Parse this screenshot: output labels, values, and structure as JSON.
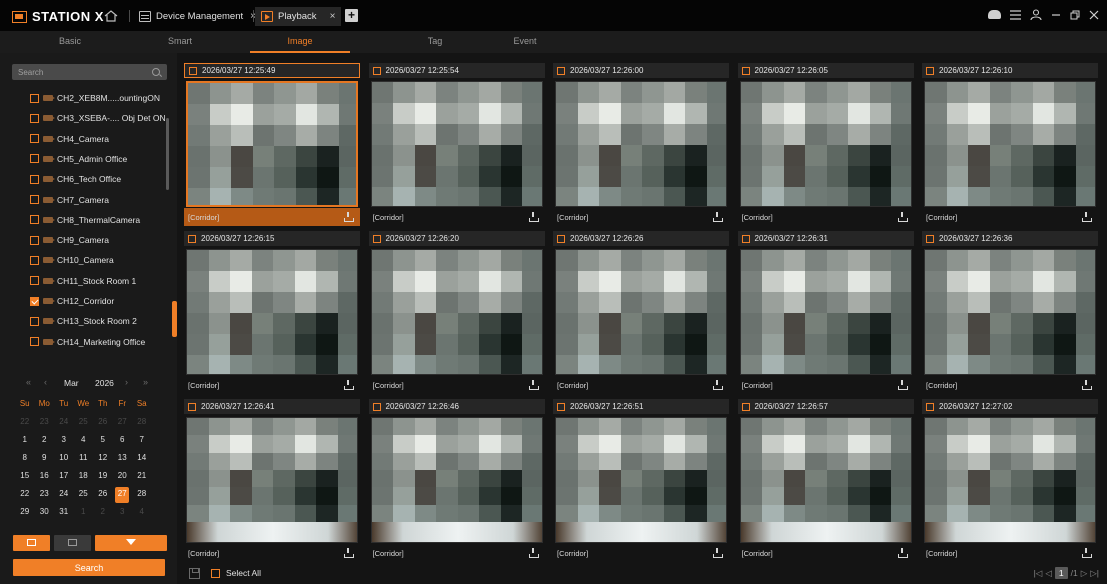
{
  "app": {
    "title": "STATION X"
  },
  "tabs": [
    {
      "label": "Device Management",
      "close": "×"
    },
    {
      "label": "Playback",
      "close": "×"
    }
  ],
  "add_tab": "+",
  "window_controls": [
    "cloud-icon",
    "menu-icon",
    "user-icon",
    "minimize-icon",
    "restore-icon",
    "close-icon"
  ],
  "subtabs": [
    "Basic",
    "Smart",
    "Image",
    "Tag",
    "Event"
  ],
  "active_subtab": "Image",
  "search": {
    "placeholder": "Search"
  },
  "channels": [
    {
      "label": "CH2_XEB8M.....ountingON",
      "checked": false
    },
    {
      "label": "CH3_XSEBA-.... Obj Det ON",
      "checked": false
    },
    {
      "label": "CH4_Camera",
      "checked": false
    },
    {
      "label": "CH5_Admin Office",
      "checked": false
    },
    {
      "label": "CH6_Tech Office",
      "checked": false
    },
    {
      "label": "CH7_Camera",
      "checked": false
    },
    {
      "label": "CH8_ThermalCamera",
      "checked": false
    },
    {
      "label": "CH9_Camera",
      "checked": false
    },
    {
      "label": "CH10_Camera",
      "checked": false
    },
    {
      "label": "CH11_Stock Room 1",
      "checked": false
    },
    {
      "label": "CH12_Corridor",
      "checked": true
    },
    {
      "label": "CH13_Stock Room 2",
      "checked": false
    },
    {
      "label": "CH14_Marketing Office",
      "checked": false
    }
  ],
  "calendar": {
    "month": "Mar",
    "year": "2026",
    "nav": [
      "«",
      "‹",
      "›",
      "»"
    ],
    "weekdays": [
      "Su",
      "Mo",
      "Tu",
      "We",
      "Th",
      "Fr",
      "Sa"
    ],
    "weeks": [
      [
        "22",
        "23",
        "24",
        "25",
        "26",
        "27",
        "28"
      ],
      [
        "1",
        "2",
        "3",
        "4",
        "5",
        "6",
        "7"
      ],
      [
        "8",
        "9",
        "10",
        "11",
        "12",
        "13",
        "14"
      ],
      [
        "15",
        "16",
        "17",
        "18",
        "19",
        "20",
        "21"
      ],
      [
        "22",
        "23",
        "24",
        "25",
        "26",
        "27",
        "28"
      ],
      [
        "29",
        "30",
        "31",
        "1",
        "2",
        "3",
        "4"
      ]
    ],
    "selected": "27"
  },
  "search_button": "Search",
  "images": [
    {
      "time": "2026/03/27 12:25:49",
      "camera": "[Corridor]",
      "selected": true
    },
    {
      "time": "2026/03/27 12:25:54",
      "camera": "[Corridor]"
    },
    {
      "time": "2026/03/27 12:26:00",
      "camera": "[Corridor]"
    },
    {
      "time": "2026/03/27 12:26:05",
      "camera": "[Corridor]"
    },
    {
      "time": "2026/03/27 12:26:10",
      "camera": "[Corridor]"
    },
    {
      "time": "2026/03/27 12:26:15",
      "camera": "[Corridor]"
    },
    {
      "time": "2026/03/27 12:26:20",
      "camera": "[Corridor]"
    },
    {
      "time": "2026/03/27 12:26:26",
      "camera": "[Corridor]"
    },
    {
      "time": "2026/03/27 12:26:31",
      "camera": "[Corridor]"
    },
    {
      "time": "2026/03/27 12:26:36",
      "camera": "[Corridor]"
    },
    {
      "time": "2026/03/27 12:26:41",
      "camera": "[Corridor]"
    },
    {
      "time": "2026/03/27 12:26:46",
      "camera": "[Corridor]"
    },
    {
      "time": "2026/03/27 12:26:51",
      "camera": "[Corridor]"
    },
    {
      "time": "2026/03/27 12:26:57",
      "camera": "[Corridor]"
    },
    {
      "time": "2026/03/27 12:27:02",
      "camera": "[Corridor]"
    }
  ],
  "footer": {
    "select_all": "Select All",
    "page_current": "1",
    "page_total": "/1",
    "first": "|◁",
    "prev": "◁",
    "next": "▷",
    "last": "▷|"
  },
  "colors": {
    "accent": "#f07f27",
    "background": "#141414",
    "panel": "#1a1a1a"
  }
}
